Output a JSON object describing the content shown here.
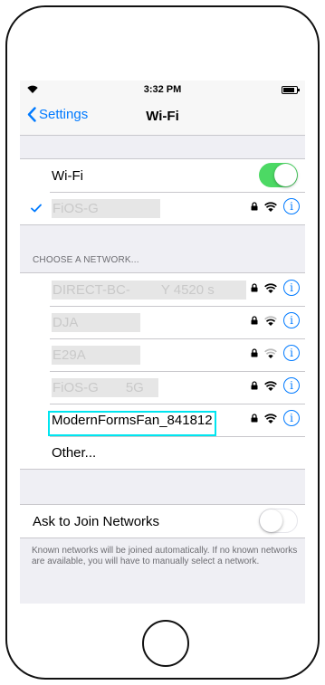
{
  "status_bar": {
    "time": "3:32 PM"
  },
  "nav": {
    "back_label": "Settings",
    "title": "Wi-Fi"
  },
  "wifi": {
    "label": "Wi-Fi",
    "enabled": true
  },
  "connected_network": {
    "name": "FiOS-G"
  },
  "choose_header": "CHOOSE A NETWORK...",
  "networks": [
    {
      "name": "DIRECT-BC-",
      "suffix": "Y 4520 s",
      "secured": true,
      "signal": "strong"
    },
    {
      "name": "DJA",
      "secured": true,
      "signal": "medium"
    },
    {
      "name": "E29A",
      "secured": true,
      "signal": "weak"
    },
    {
      "name": "FiOS-G",
      "suffix": "5G",
      "secured": true,
      "signal": "strong"
    },
    {
      "name": "ModernFormsFan_841812",
      "secured": true,
      "signal": "strong"
    }
  ],
  "other_label": "Other...",
  "ask_to_join": {
    "label": "Ask to Join Networks",
    "enabled": false
  },
  "footer": "Known networks will be joined automatically. If no known networks are available, you will have to manually select a network.",
  "colors": {
    "accent": "#007aff",
    "toggle_on": "#4cd964",
    "highlight": "#00e5f0"
  },
  "icons": {
    "info": "i"
  }
}
